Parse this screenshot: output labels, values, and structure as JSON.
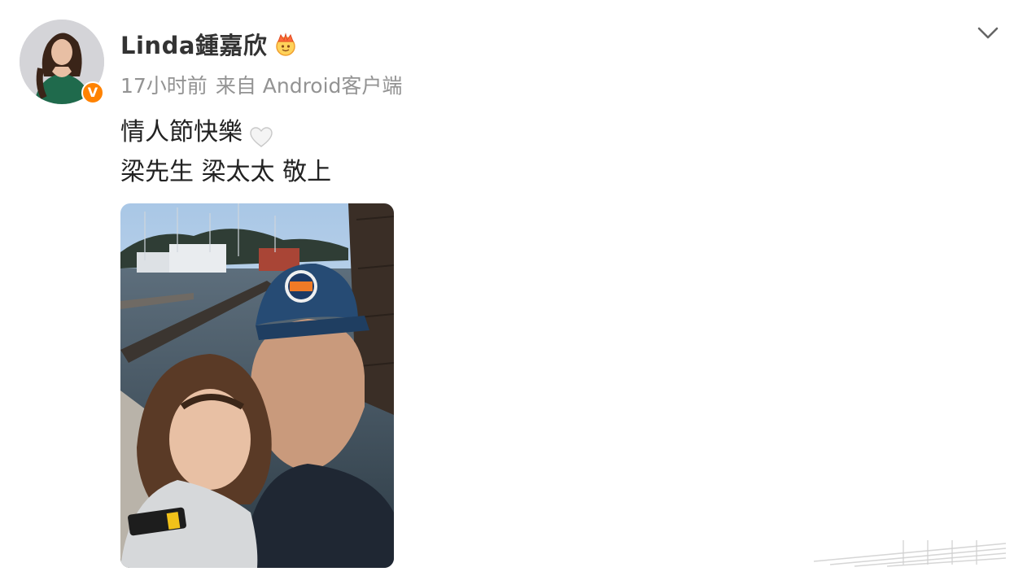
{
  "post": {
    "author": {
      "name": "Linda鍾嘉欣",
      "badge_letter": "V",
      "crown_icon": "crown-icon"
    },
    "meta": {
      "time": "17小时前",
      "source": "来自 Android客户端"
    },
    "content": {
      "line1": "情人節快樂",
      "line1_icon": "white-heart-icon",
      "line2": "梁先生 梁太太 敬上"
    },
    "menu_icon": "chevron-down-icon",
    "colors": {
      "name": "#333333",
      "meta": "#939393",
      "text": "#222222",
      "verified_badge": "#ff8200"
    }
  }
}
